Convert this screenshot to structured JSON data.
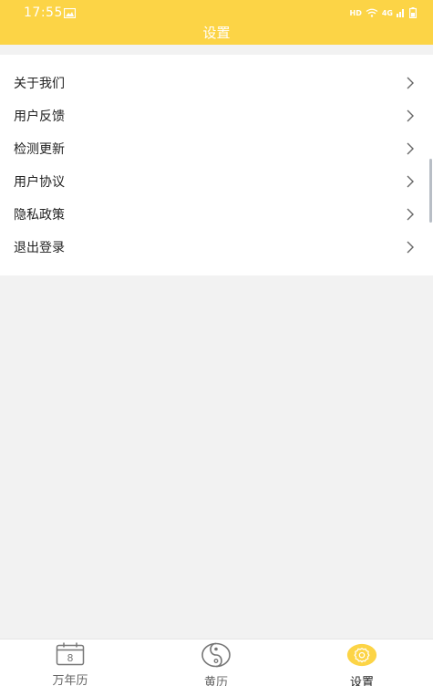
{
  "status_bar": {
    "time": "17:55",
    "network_label": "HD",
    "signal_label": "4G"
  },
  "header": {
    "title": "设置"
  },
  "menu": {
    "items": [
      {
        "label": "关于我们"
      },
      {
        "label": "用户反馈"
      },
      {
        "label": "检测更新"
      },
      {
        "label": "用户协议"
      },
      {
        "label": "隐私政策"
      },
      {
        "label": "退出登录"
      }
    ]
  },
  "tab_bar": {
    "tabs": [
      {
        "label": "万年历",
        "icon": "calendar-icon",
        "icon_text": "8",
        "active": false
      },
      {
        "label": "黄历",
        "icon": "yin-yang-icon",
        "active": false
      },
      {
        "label": "设置",
        "icon": "gear-icon",
        "active": true
      }
    ]
  },
  "colors": {
    "accent": "#fcd446",
    "background": "#f2f2f2",
    "text": "#222222",
    "muted": "#666666"
  }
}
